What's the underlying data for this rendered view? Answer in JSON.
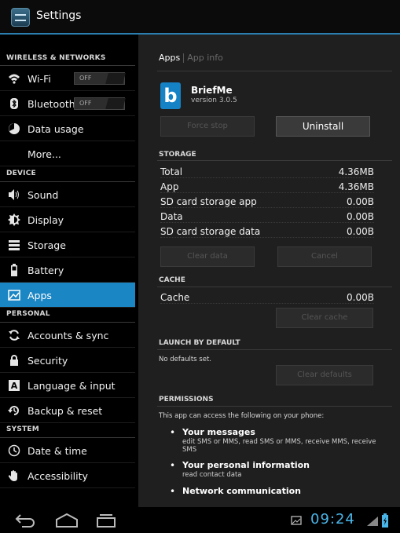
{
  "titlebar": {
    "title": "Settings"
  },
  "sidebar": {
    "wireless_header": "WIRELESS & NETWORKS",
    "wifi": {
      "label": "Wi-Fi",
      "toggle": "OFF"
    },
    "bluetooth": {
      "label": "Bluetooth",
      "toggle": "OFF"
    },
    "data_usage": "Data usage",
    "more": "More...",
    "device_header": "DEVICE",
    "sound": "Sound",
    "display": "Display",
    "storage": "Storage",
    "battery": "Battery",
    "apps": "Apps",
    "personal_header": "PERSONAL",
    "accounts": "Accounts & sync",
    "security": "Security",
    "language": "Language & input",
    "backup": "Backup & reset",
    "system_header": "SYSTEM",
    "datetime": "Date & time",
    "accessibility": "Accessibility"
  },
  "panel": {
    "tab_active": "Apps",
    "tab_inactive": "App info",
    "app_name": "BriefMe",
    "app_version": "version 3.0.5",
    "force_stop": "Force stop",
    "uninstall": "Uninstall",
    "storage_header": "STORAGE",
    "storage_rows": [
      {
        "label": "Total",
        "value": "4.36MB"
      },
      {
        "label": "App",
        "value": "4.36MB"
      },
      {
        "label": "SD card storage app",
        "value": "0.00B"
      },
      {
        "label": "Data",
        "value": "0.00B"
      },
      {
        "label": "SD card storage data",
        "value": "0.00B"
      }
    ],
    "clear_data": "Clear data",
    "cancel": "Cancel",
    "cache_header": "CACHE",
    "cache_label": "Cache",
    "cache_value": "0.00B",
    "clear_cache": "Clear cache",
    "launch_header": "LAUNCH BY DEFAULT",
    "no_defaults": "No defaults set.",
    "clear_defaults": "Clear defaults",
    "permissions_header": "PERMISSIONS",
    "permissions_intro": "This app can access the following on your phone:",
    "permissions": [
      {
        "title": "Your messages",
        "desc": "edit SMS or MMS, read SMS or MMS, receive MMS, receive SMS"
      },
      {
        "title": "Your personal information",
        "desc": "read contact data"
      },
      {
        "title": "Network communication",
        "desc": ""
      }
    ]
  },
  "statusbar": {
    "time": "09:24"
  },
  "colors": {
    "accent": "#1b86c4",
    "clock": "#4ab5e8"
  }
}
